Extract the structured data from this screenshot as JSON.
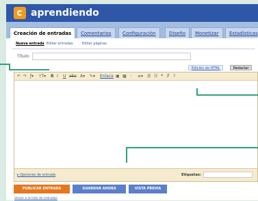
{
  "app": {
    "name": "aprendiendo",
    "brand_color": "#2f57a8",
    "accent_color": "#e4781f",
    "callout_color": "#2ea07d",
    "logo_icon": "blogger-logo-icon"
  },
  "main_tabs": [
    {
      "label": "Creación de entradas",
      "active": true
    },
    {
      "label": "Comentarios",
      "active": false
    },
    {
      "label": "Configuración",
      "active": false
    },
    {
      "label": "Diseño",
      "active": false
    },
    {
      "label": "Monetizar",
      "active": false
    },
    {
      "label": "Estadísticas",
      "active": false
    }
  ],
  "sub_tabs": [
    {
      "label": "Nueva entrada",
      "active": true
    },
    {
      "label": "Editar entradas",
      "active": false
    },
    {
      "label": "Editar páginas",
      "active": false
    }
  ],
  "post_form": {
    "title_label": "Título:",
    "title_value": "",
    "mode_html": "Edición de HTML",
    "mode_compose": "Redactar"
  },
  "toolbar": {
    "items": [
      {
        "icon": "undo-icon",
        "glyph": "↶"
      },
      {
        "icon": "redo-icon",
        "glyph": "↷"
      },
      {
        "icon": "font-icon",
        "glyph": "ƒ▾"
      },
      {
        "icon": "font-size-icon",
        "glyph": "ᴛT▾"
      },
      {
        "icon": "bold-icon",
        "glyph": "B"
      },
      {
        "icon": "italic-icon",
        "glyph": "I"
      },
      {
        "icon": "underline-icon",
        "glyph": "U"
      },
      {
        "icon": "strikethrough-icon",
        "glyph": "abc"
      },
      {
        "icon": "text-color-icon",
        "glyph": "A▾"
      },
      {
        "icon": "highlight-icon",
        "glyph": "✎▾"
      }
    ],
    "link_label": "Enlace",
    "items_right": [
      {
        "icon": "image-icon",
        "glyph": "▣"
      },
      {
        "icon": "video-icon",
        "glyph": "▦"
      },
      {
        "icon": "jump-break-icon",
        "glyph": "⫶"
      },
      {
        "icon": "align-icon",
        "glyph": "≡▾"
      },
      {
        "icon": "numbered-list-icon",
        "glyph": "☰"
      },
      {
        "icon": "bullet-list-icon",
        "glyph": "☷"
      },
      {
        "icon": "quote-icon",
        "glyph": "❝"
      },
      {
        "icon": "clear-format-icon",
        "glyph": "T̸"
      },
      {
        "icon": "spellcheck-icon",
        "glyph": "?"
      }
    ]
  },
  "editor": {
    "options_link": "▸ Opciones de entrada",
    "labels_label": "Etiquetas:",
    "labels_value": ""
  },
  "actions": {
    "publish": "PUBLICAR ENTRADA",
    "save": "GUARDAR AHORA",
    "preview": "VISTA PREVIA"
  },
  "back_link": "Volver a la lista de entradas"
}
